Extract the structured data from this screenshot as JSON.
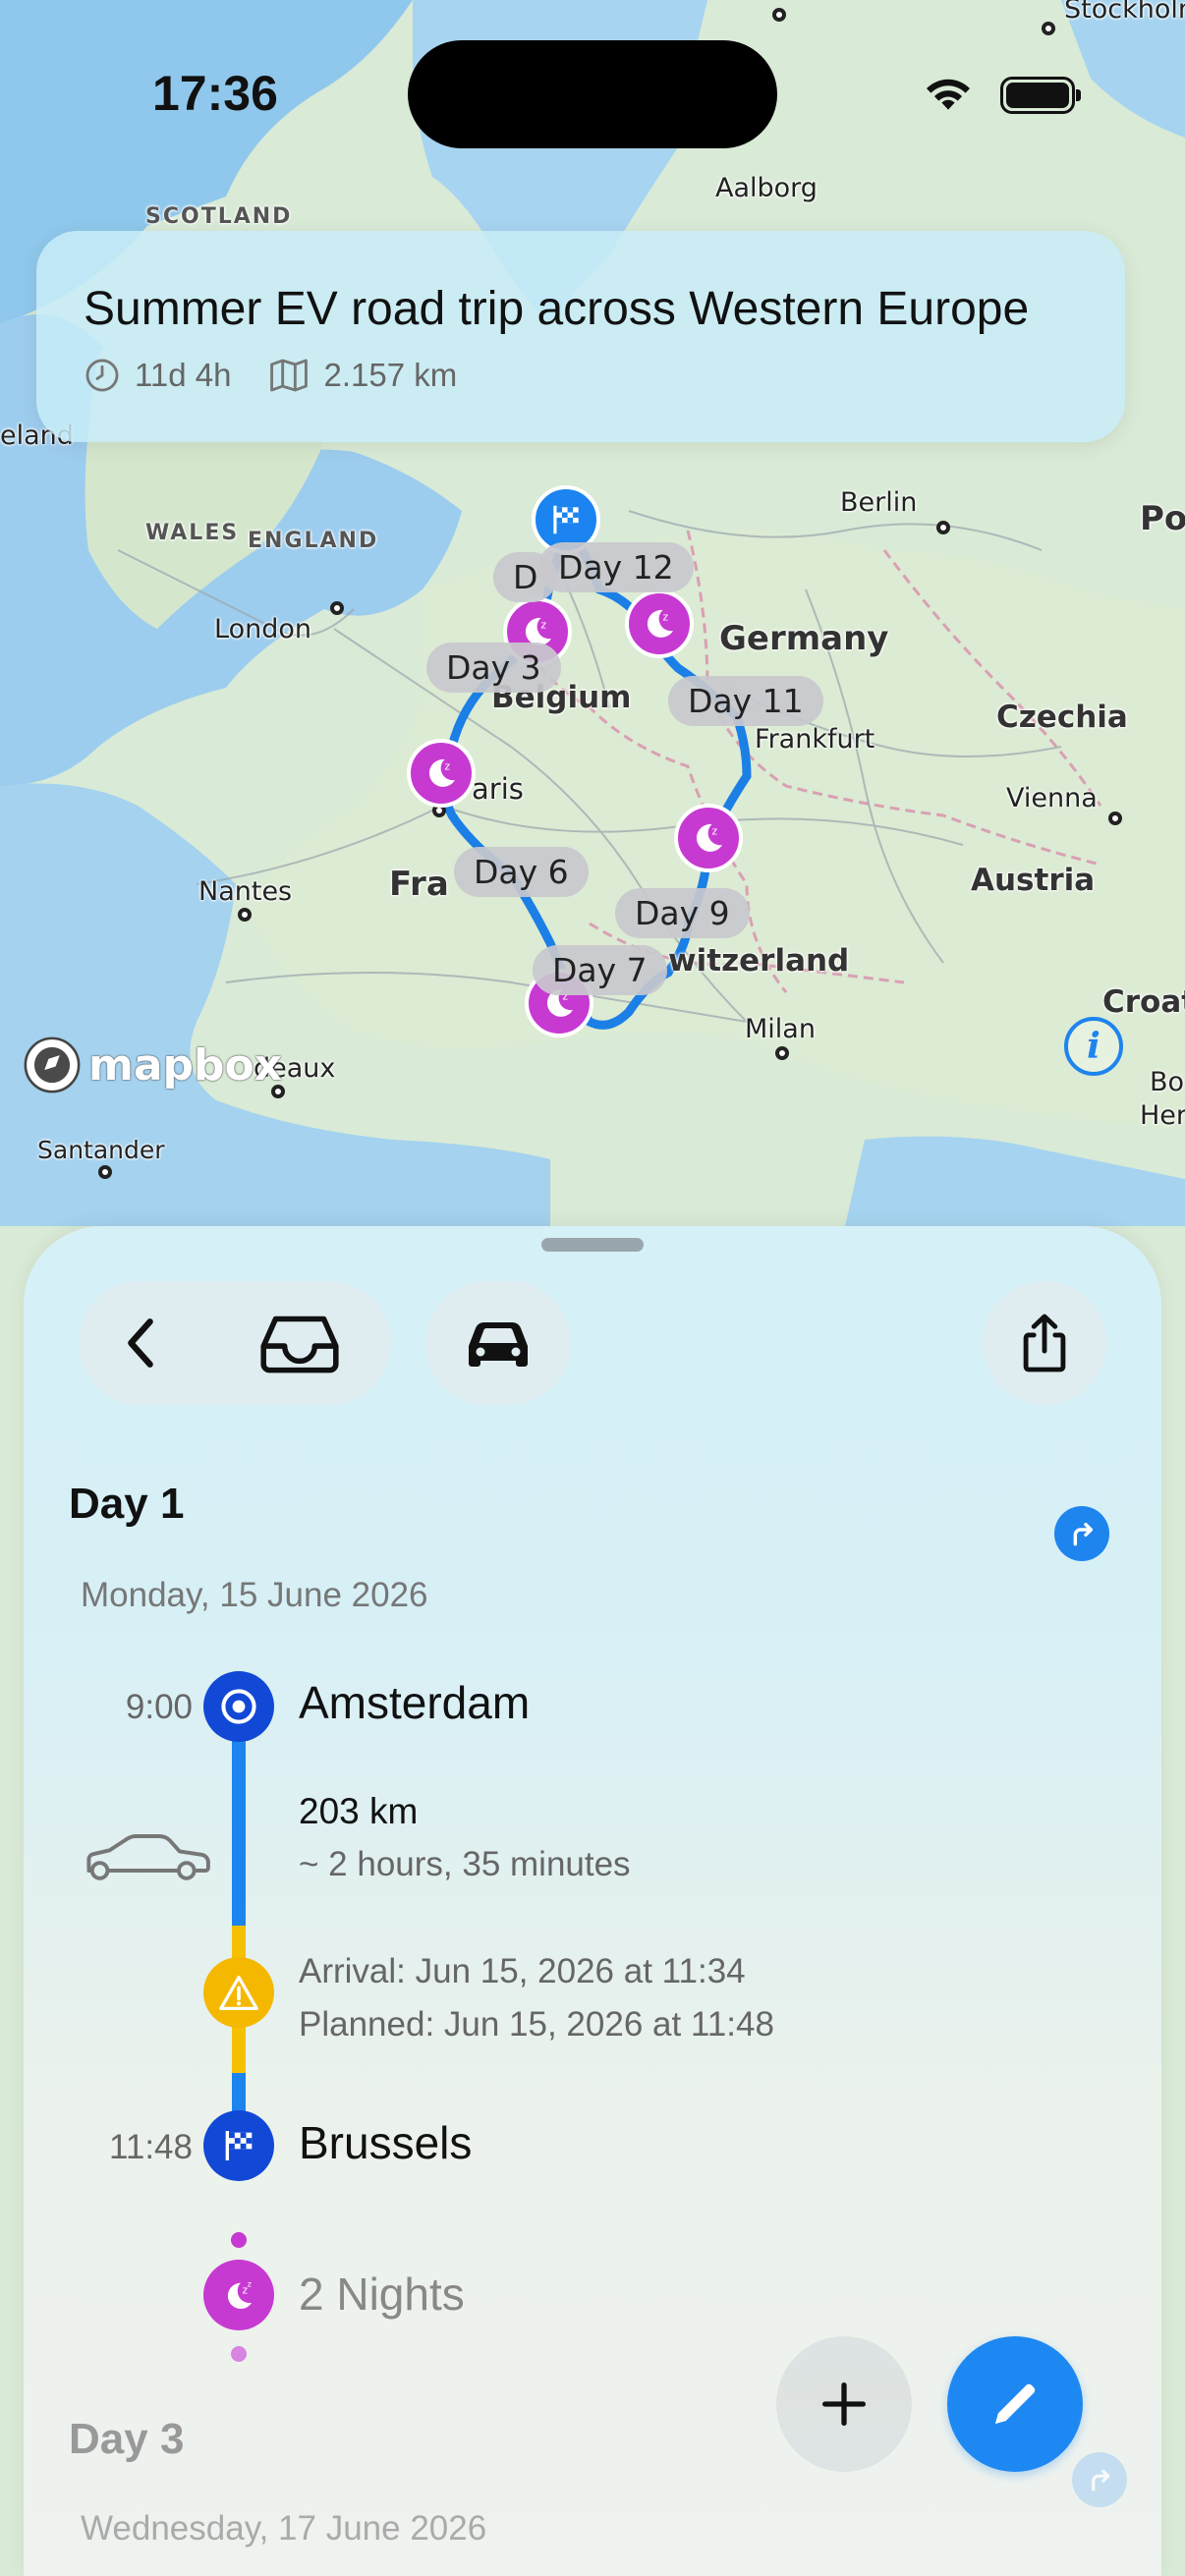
{
  "status_bar": {
    "time": "17:36"
  },
  "trip": {
    "title": "Summer EV road trip across Western Europe",
    "duration": "11d 4h",
    "distance": "2.157 km"
  },
  "map": {
    "labels": {
      "scotland": "SCOTLAND",
      "wales": "WALES",
      "england": "ENGLAND",
      "london": "London",
      "ireland": "eland",
      "aalborg": "Aalborg",
      "stockholm": "Stockholm",
      "berlin": "Berlin",
      "germany": "Germany",
      "po": "Po",
      "czechia": "Czechia",
      "frankfurt": "Frankfurt",
      "vienna": "Vienna",
      "austria": "Austria",
      "belgium": "Belgium",
      "paris": "aris",
      "france": "Fra",
      "nantes": "Nantes",
      "switzerland": "witzerland",
      "milan": "Milan",
      "croat": "Croat",
      "bordeaux": "deaux",
      "santander": "Santander",
      "bo": "Bo",
      "her": "Her"
    },
    "day_tags": {
      "d12": "Day 12",
      "d_partial": "D",
      "d3": "Day 3",
      "d11": "Day 11",
      "d6": "Day 6",
      "d9": "Day 9",
      "d7": "Day 7"
    },
    "attribution": "mapbox"
  },
  "colors": {
    "accent": "#1e84ee",
    "overnight": "#c73ad2",
    "warning": "#f5b800",
    "route": "#1b7fe6"
  },
  "itinerary": {
    "day1": {
      "title": "Day 1",
      "date": "Monday, 15 June 2026",
      "start": {
        "time": "9:00",
        "name": "Amsterdam"
      },
      "leg": {
        "distance": "203 km",
        "duration": "~ 2 hours, 35 minutes"
      },
      "warning": {
        "arrival": "Arrival: Jun 15, 2026 at 11:34",
        "planned": "Planned: Jun 15, 2026 at 11:48"
      },
      "end": {
        "time": "11:48",
        "name": "Brussels"
      },
      "stay": "2 Nights"
    },
    "day3": {
      "title": "Day 3",
      "date": "Wednesday, 17 June 2026"
    }
  }
}
